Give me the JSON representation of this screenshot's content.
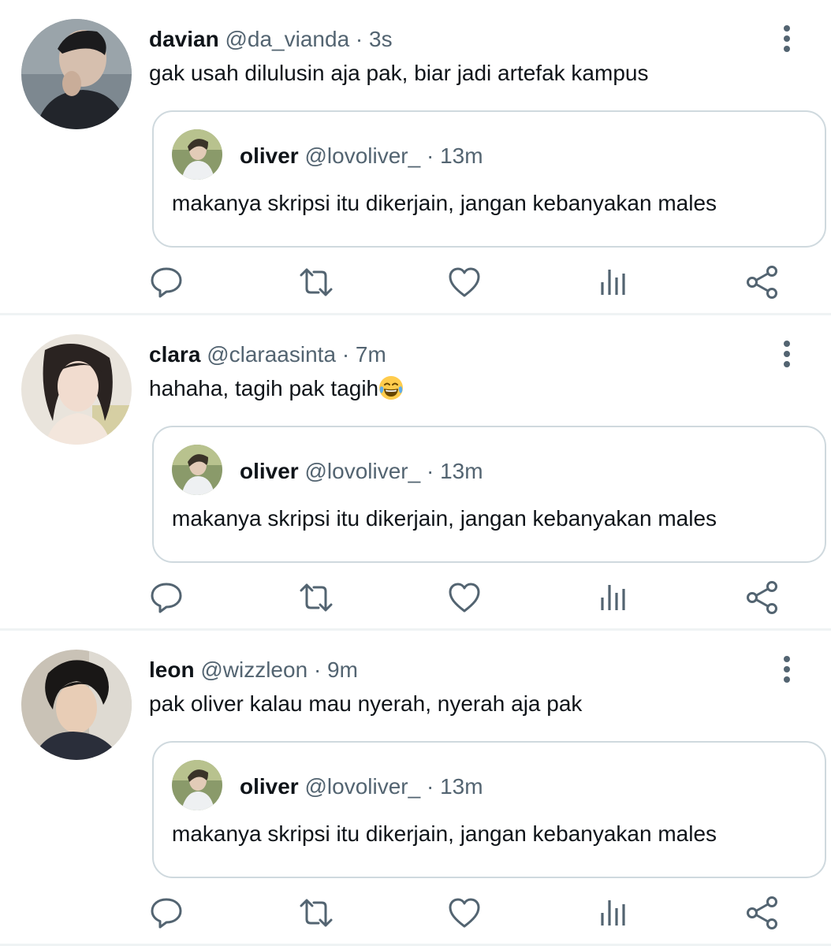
{
  "colors": {
    "text": "#0f1419",
    "secondary": "#536471",
    "divider": "#eff3f4",
    "border": "#cfd9de"
  },
  "tweets": [
    {
      "name": "davian",
      "handle": "@da_vianda",
      "dot": "·",
      "time": "3s",
      "text": "gak usah dilulusin aja pak, biar jadi artefak kampus",
      "emoji": "",
      "quote": {
        "name": "oliver",
        "handle": "@lovoliver_",
        "dot": "·",
        "time": "13m",
        "text": "makanya skripsi itu dikerjain, jangan kebanyakan males"
      }
    },
    {
      "name": "clara",
      "handle": "@claraasinta",
      "dot": "·",
      "time": "7m",
      "text": "hahaha, tagih pak tagih",
      "emoji": "face-with-tears-of-joy",
      "quote": {
        "name": "oliver",
        "handle": "@lovoliver_",
        "dot": "·",
        "time": "13m",
        "text": "makanya skripsi itu dikerjain, jangan kebanyakan males"
      }
    },
    {
      "name": "leon",
      "handle": "@wizzleon",
      "dot": "·",
      "time": "9m",
      "text": "pak oliver kalau mau nyerah, nyerah aja pak",
      "emoji": "",
      "quote": {
        "name": "oliver",
        "handle": "@lovoliver_",
        "dot": "·",
        "time": "13m",
        "text": "makanya skripsi itu dikerjain, jangan kebanyakan males"
      }
    }
  ],
  "icons": {
    "more": "more-vertical-icon",
    "reply": "reply-icon",
    "retweet": "retweet-icon",
    "like": "heart-icon",
    "views": "views-icon",
    "share": "share-icon",
    "emoji": "face-with-tears-of-joy"
  }
}
